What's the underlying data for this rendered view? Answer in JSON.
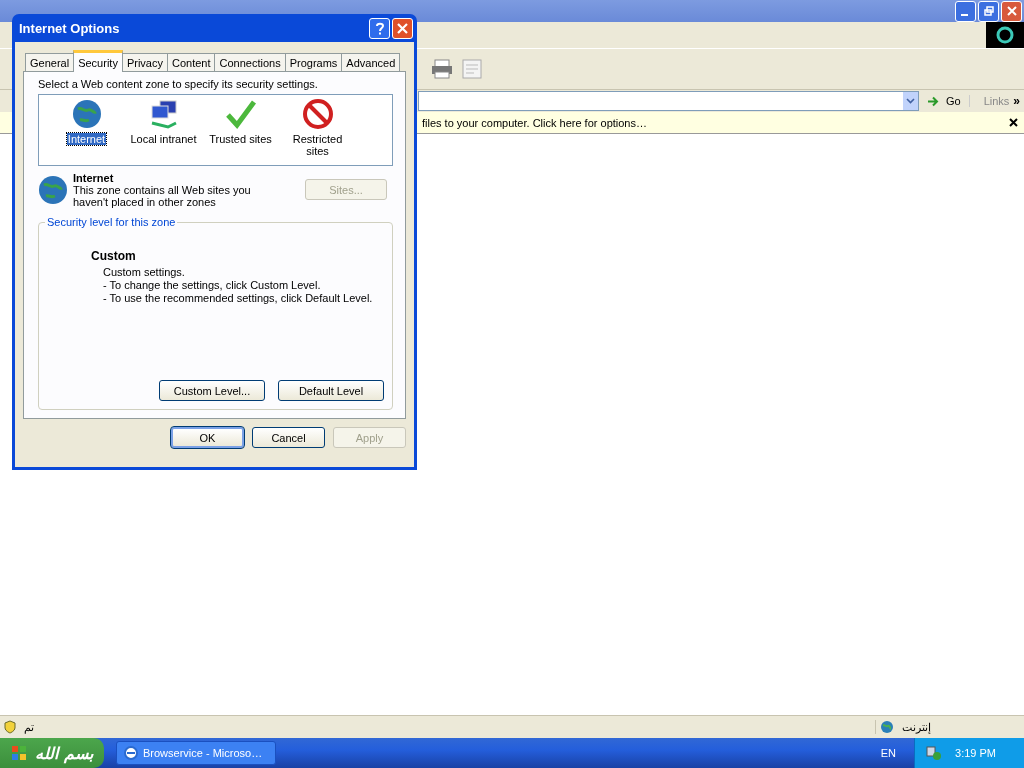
{
  "browser": {
    "address_bar": {
      "go_button": "Go",
      "links_label": "Links",
      "chevron": "»"
    },
    "info_bar": {
      "text": "files to your computer. Click here for options…"
    },
    "status_bar": {
      "text": "تم",
      "zone": "إنترنت"
    }
  },
  "dialog": {
    "title": "Internet Options",
    "tabs": [
      {
        "label": "General",
        "selected": false
      },
      {
        "label": "Security",
        "selected": true
      },
      {
        "label": "Privacy",
        "selected": false
      },
      {
        "label": "Content",
        "selected": false
      },
      {
        "label": "Connections",
        "selected": false
      },
      {
        "label": "Programs",
        "selected": false
      },
      {
        "label": "Advanced",
        "selected": false
      }
    ],
    "prompt": "Select a Web content zone to specify its security settings.",
    "zones": [
      {
        "kind": "internet",
        "label": "Internet",
        "selected": true
      },
      {
        "kind": "intranet",
        "label": "Local intranet",
        "selected": false
      },
      {
        "kind": "trusted",
        "label": "Trusted sites",
        "selected": false
      },
      {
        "kind": "restricted",
        "label": "Restricted sites",
        "selected": false
      }
    ],
    "zone_info": {
      "name": "Internet",
      "description": "This zone contains all Web sites you haven't placed in other zones",
      "sites_button": {
        "label": "Sites...",
        "disabled": true
      }
    },
    "security_level": {
      "group_label": "Security level for this zone",
      "level_name": "Custom",
      "lines": [
        "Custom settings.",
        "- To change the settings, click Custom Level.",
        "- To use the recommended settings, click Default Level."
      ],
      "buttons": [
        "Custom Level...",
        "Default Level"
      ]
    },
    "footer_buttons": [
      {
        "label": "OK",
        "disabled": false,
        "default": true
      },
      {
        "label": "Cancel",
        "disabled": false,
        "default": false
      },
      {
        "label": "Apply",
        "disabled": true,
        "default": false
      }
    ]
  },
  "taskbar": {
    "start_label": "بسم الله",
    "task": "Browservice - Microso…",
    "language": "EN",
    "clock": "3:19 PM"
  }
}
